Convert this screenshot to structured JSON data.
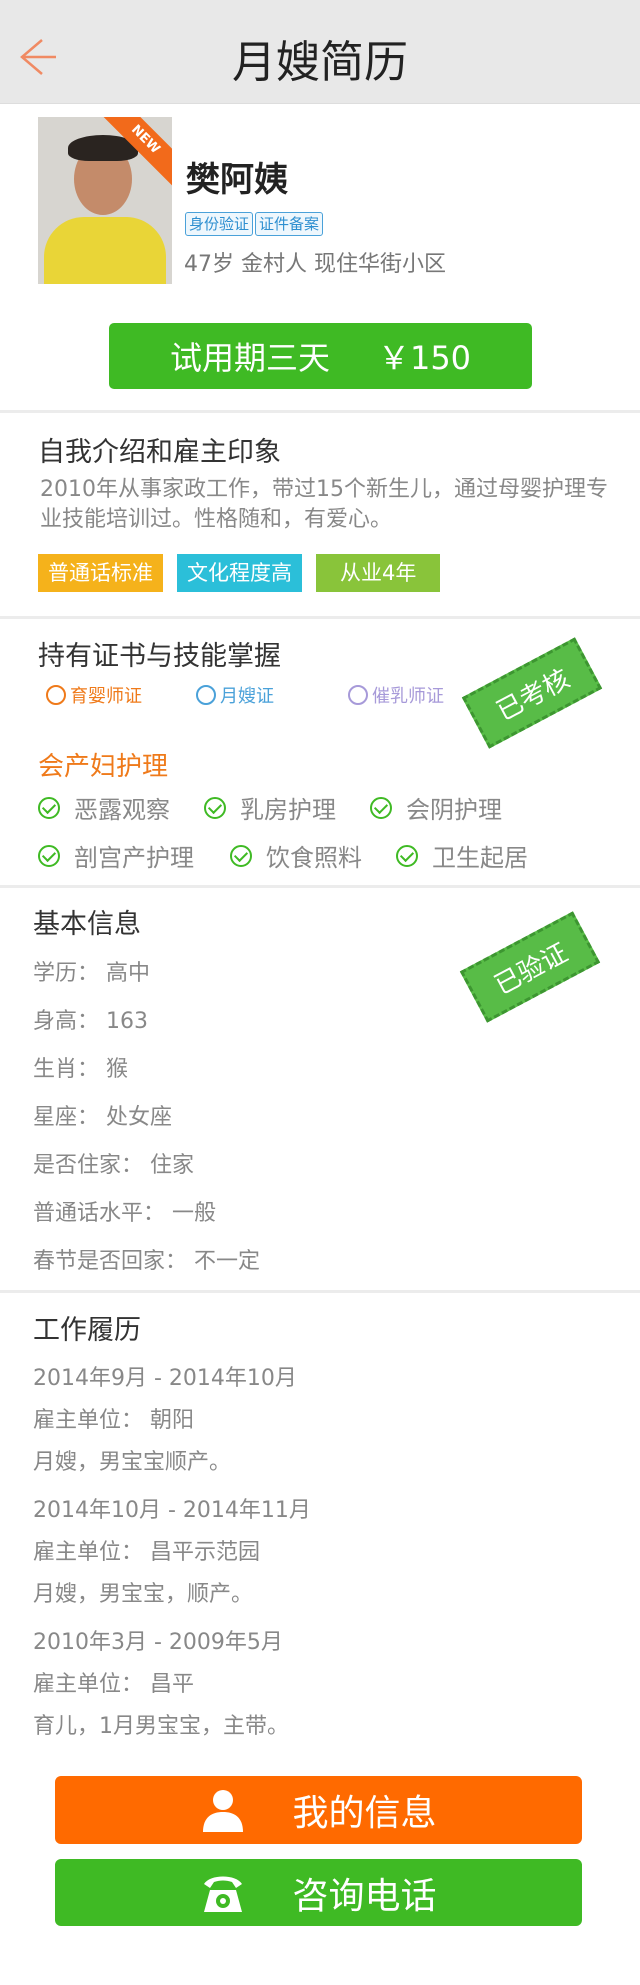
{
  "header": {
    "title": "月嫂简历"
  },
  "profile": {
    "name": "樊阿姨",
    "avatar_tag": "NEW",
    "badges": [
      "身份验证",
      "证件备案"
    ],
    "meta": "47岁  金村人  现住华街小区",
    "trial_label": "试用期三天",
    "trial_price": "￥150"
  },
  "intro": {
    "title": "自我介绍和雇主印象",
    "desc": "2010年从事家政工作，带过15个新生儿，通过母婴护理专业技能培训过。性格随和，有爱心。",
    "tags": [
      {
        "label": "普通话标准",
        "color": "#f5b21b"
      },
      {
        "label": "文化程度高",
        "color": "#2bbfd9"
      },
      {
        "label": "从业4年",
        "color": "#89c43a"
      }
    ]
  },
  "certs": {
    "title": "持有证书与技能掌握",
    "items": [
      {
        "label": "育婴师证",
        "color": "#ef7a1a"
      },
      {
        "label": "月嫂证",
        "color": "#4aa1d9"
      },
      {
        "label": "催乳师证",
        "color": "#a79ad9"
      }
    ],
    "stamp": "已考核",
    "skill_title": "会产妇护理",
    "skills": [
      "恶露观察",
      "乳房护理",
      "会阴护理",
      "剖宫产护理",
      "饮食照料",
      "卫生起居"
    ]
  },
  "basic": {
    "title": "基本信息",
    "stamp": "已验证",
    "rows": [
      "学历： 高中",
      "身高： 163",
      "生肖： 猴",
      "星座： 处女座",
      "是否住家： 住家",
      "普通话水平： 一般",
      "春节是否回家： 不一定"
    ]
  },
  "work": {
    "title": "工作履历",
    "jobs": [
      {
        "period": "2014年9月 - 2014年10月",
        "employer": "雇主单位： 朝阳",
        "note": "月嫂，男宝宝顺产。"
      },
      {
        "period": "2014年10月 - 2014年11月",
        "employer": "雇主单位： 昌平示范园",
        "note": "月嫂，男宝宝，顺产。"
      },
      {
        "period": "2010年3月 - 2009年5月",
        "employer": "雇主单位： 昌平",
        "note": "育儿，1月男宝宝，主带。"
      }
    ]
  },
  "actions": {
    "my_info": "我的信息",
    "consult": "咨询电话",
    "my_info_color": "#ff6a00",
    "consult_color": "#3fba24"
  }
}
